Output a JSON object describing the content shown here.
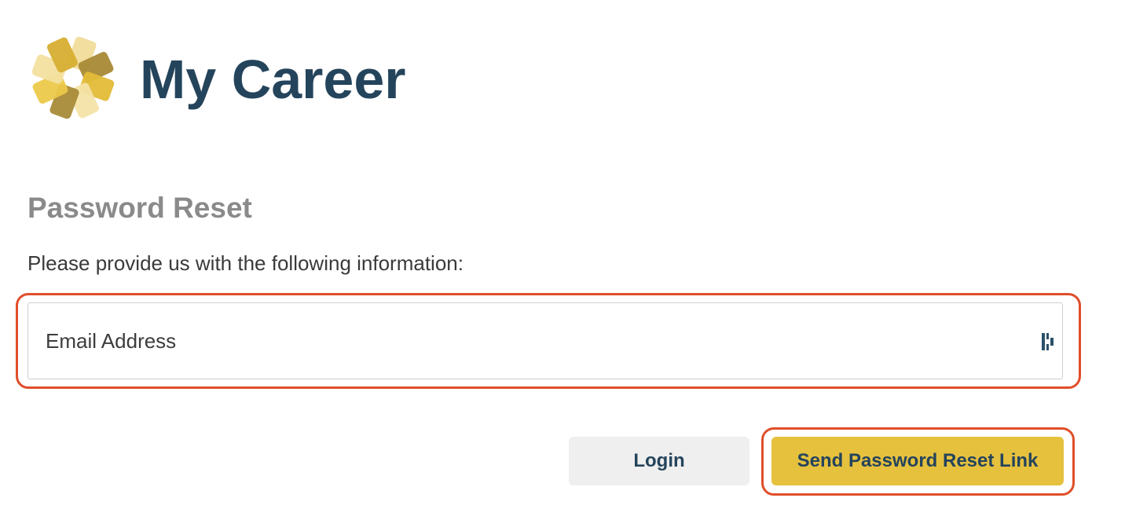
{
  "header": {
    "app_title": "My Career",
    "logo_icon": "sunburst-logo-icon"
  },
  "form": {
    "heading": "Password Reset",
    "instructions": "Please provide us with the following information:",
    "email": {
      "placeholder": "Email Address",
      "value": "",
      "trailing_icon": "password-manager-icon"
    }
  },
  "actions": {
    "login_label": "Login",
    "send_label": "Send Password Reset Link"
  },
  "colors": {
    "title": "#24445c",
    "heading": "#8a8a8a",
    "primary_button": "#e6c13e",
    "secondary_button": "#efefef",
    "annotation_highlight": "#e04e2a"
  }
}
